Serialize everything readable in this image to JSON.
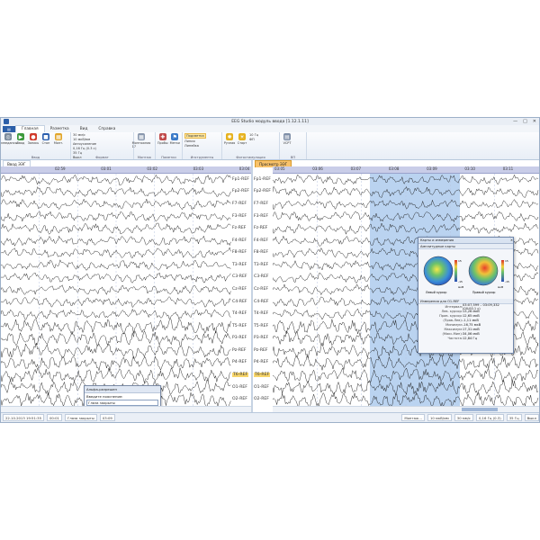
{
  "window": {
    "title": "EEG Studio модуль ввода [1.12.1.11]",
    "min_label": "—",
    "max_label": "□",
    "close_label": "✕"
  },
  "menu": {
    "file_label": "▤",
    "tabs": [
      "Главная",
      "Разметка",
      "Вид",
      "Справка"
    ]
  },
  "ribbon": {
    "groups": [
      {
        "label": "Ввод",
        "buttons": [
          {
            "label": "Импедансы",
            "icon": "headset-icon",
            "color": "#7a8a9c"
          },
          {
            "label": "Ввод",
            "icon": "play-icon",
            "color": "#3c9a3c"
          },
          {
            "label": "Запись",
            "icon": "record-icon",
            "color": "#d03a2a"
          },
          {
            "label": "Стоп",
            "icon": "stop-icon",
            "color": "#2b5fae"
          },
          {
            "label": "Монт.",
            "icon": "montage-icon",
            "color": "#e1a52a"
          }
        ]
      },
      {
        "label": "Формат",
        "small": [
          "30 мм/с",
          "10 мкВ/мм",
          "Автоусиление",
          "0,16 Гц (0.3 с)",
          "35 Гц",
          "Выкл"
        ]
      },
      {
        "label": "Монтаж",
        "buttons": [
          {
            "label": "Монтажная 17",
            "icon": "montage-grid-icon",
            "color": "#8a98ae"
          }
        ]
      },
      {
        "label": "Пометки",
        "buttons": [
          {
            "label": "Пробы",
            "icon": "probe-icon",
            "color": "#c04a4a"
          },
          {
            "label": "Метки",
            "icon": "mark-icon",
            "color": "#3a7ac8"
          }
        ]
      },
      {
        "label": "Инструменты",
        "small": [
          "Подсветка",
          "Линия",
          "Линейка"
        ]
      },
      {
        "label": "Фотостимуляция",
        "buttons": [
          {
            "label": "Ручная",
            "icon": "lamp-icon",
            "color": "#e6b21e"
          },
          {
            "label": "Старт",
            "icon": "sun-icon",
            "color": "#e6b21e"
          }
        ],
        "small": [
          "10 Гц",
          "ФП"
        ]
      },
      {
        "label": "ВП",
        "buttons": [
          {
            "label": "VCPT",
            "icon": "vcpt-icon",
            "color": "#7f8fa8"
          }
        ]
      }
    ]
  },
  "left_pane": {
    "tab": "Ввод ЭЭГ",
    "ruler": [
      "02:59",
      "03:01",
      "03:02",
      "03:03",
      "03:04"
    ]
  },
  "right_pane": {
    "tab": "Просмотр ЭЭГ",
    "ruler": [
      "03:05",
      "03:06",
      "03:07",
      "03:08",
      "03:09",
      "03:10",
      "03:11"
    ]
  },
  "channels": [
    "Fp1-REF",
    "Fp2-REF",
    "F7-REF",
    "F3-REF",
    "Fz-REF",
    "F4-REF",
    "F8-REF",
    "T3-REF",
    "C3-REF",
    "Cz-REF",
    "C4-REF",
    "T4-REF",
    "T5-REF",
    "P3-REF",
    "Pz-REF",
    "P4-REF",
    "T6-REF",
    "O1-REF",
    "O2-REF"
  ],
  "highlighted_channel": "T6-REF",
  "popup": {
    "header": "Альфа-разрешен",
    "prompt": "Введите пояснение:",
    "value": "Глаза закрыты"
  },
  "map_window": {
    "title": "Карты и измерения",
    "section_maps": "Амплитудные карты",
    "map_left_label": "Левый курсор",
    "map_right_label": "Правый курсор",
    "scale_max": "15",
    "scale_min": "-15",
    "scale_unit": "мкВ",
    "section_measure": "Измерения для O1-REF",
    "rows": [
      {
        "k": "Интервал:",
        "v": "03:07,599 – 03:09,332 (00:00,1 с)"
      },
      {
        "k": "Лев. курсор:",
        "v": "13,26 мкВ"
      },
      {
        "k": "Прав. курсор:",
        "v": "12,65 мкВ"
      },
      {
        "k": "(Прав-Лев):",
        "v": "-1,11 мкВ"
      },
      {
        "k": "Минимум:",
        "v": "-16,75 мкВ"
      },
      {
        "k": "Максимум:",
        "v": "17,31 мкВ"
      },
      {
        "k": "(Макс-Мин):",
        "v": "34,06 мкВ"
      },
      {
        "k": "Частота:",
        "v": "12,84 Гц"
      }
    ]
  },
  "status": {
    "datetime": "22.10.2013 19:51:35",
    "duration": "00:01",
    "file": "Глаза закрыты",
    "time": "03:09",
    "montage": "Монтаж...",
    "gain": "10 мкВ/мм",
    "speed": "30 мм/с",
    "hp": "0,16 Гц (0.3)",
    "lp": "35 Гц",
    "notch": "Выкл"
  },
  "colors": {
    "selection": "#a9c8ec",
    "accent": "#2c5fa8",
    "highlight": "#f7d56b"
  }
}
